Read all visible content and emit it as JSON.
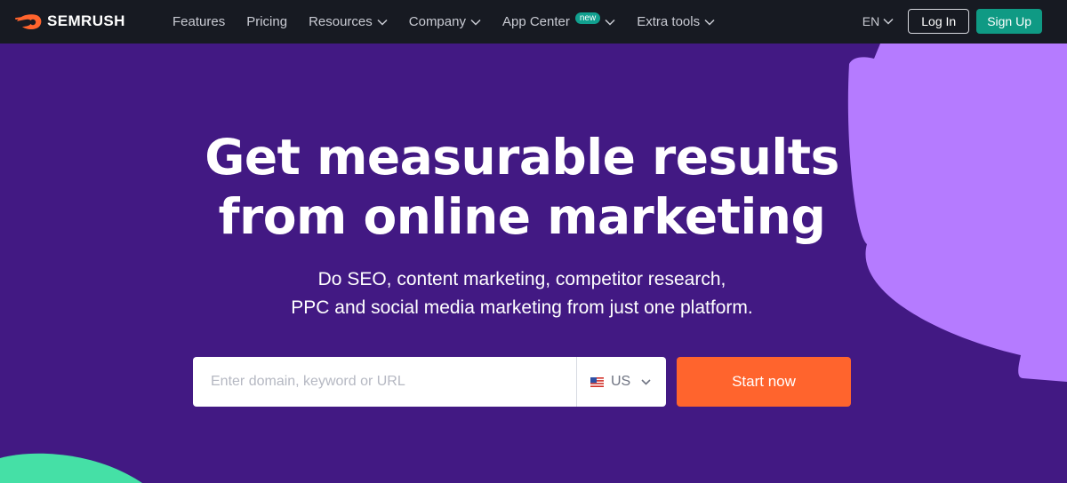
{
  "brand": {
    "name": "SEMRUSH"
  },
  "nav": {
    "items": [
      {
        "label": "Features",
        "has_dropdown": false
      },
      {
        "label": "Pricing",
        "has_dropdown": false
      },
      {
        "label": "Resources",
        "has_dropdown": true
      },
      {
        "label": "Company",
        "has_dropdown": true
      },
      {
        "label": "App Center",
        "has_dropdown": true,
        "badge": "new"
      },
      {
        "label": "Extra tools",
        "has_dropdown": true
      }
    ],
    "language": "EN",
    "login_label": "Log In",
    "signup_label": "Sign Up"
  },
  "hero": {
    "title_line1": "Get measurable results",
    "title_line2": "from online marketing",
    "subtitle_line1": "Do SEO, content marketing, competitor research,",
    "subtitle_line2": "PPC and social media marketing from just one platform."
  },
  "search": {
    "placeholder": "Enter domain, keyword or URL",
    "value": "",
    "country": "US",
    "flag_icon": "us-flag-icon",
    "submit_label": "Start now"
  },
  "colors": {
    "nav_bg": "#171a22",
    "hero_bg": "#421983",
    "accent_orange": "#ff642d",
    "signup_green": "#0f9a84",
    "deco_purple": "#b57bff",
    "deco_mint": "#45e0a6"
  }
}
